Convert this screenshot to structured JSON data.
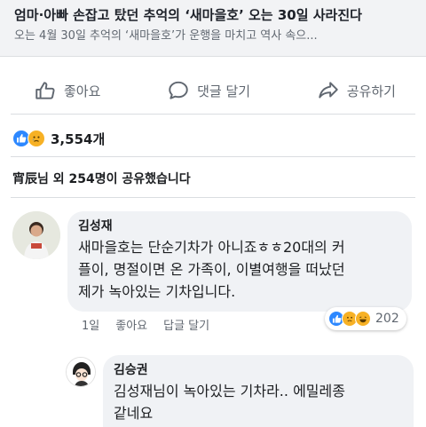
{
  "link": {
    "title": "엄마·아빠 손잡고 탔던 추억의 ‘새마을호’ 오는 30일 사라진다",
    "description": "오는 4월 30일 추억의 ‘새마을호’가 운행을 마치고 역사 속으..."
  },
  "actions": {
    "like": "좋아요",
    "comment": "댓글 달기",
    "share": "공유하기"
  },
  "reactions": {
    "count": "3,554개",
    "icons": [
      "like-icon",
      "sad-icon"
    ]
  },
  "shares": {
    "text": "宵辰님 외 254명이 공유했습니다"
  },
  "comments": [
    {
      "author": "김성재",
      "text": "새마을호는 단순기차가 아니죠ㅎㅎ20대의 커\n플이, 명절이면 온 가족이, 이별여행을 떠났던\n제가 녹아있는 기차입니다.",
      "time": "1일",
      "like_label": "좋아요",
      "reply_label": "답글 달기",
      "reaction_count": "202",
      "reaction_icons": [
        "like-icon",
        "sad-icon",
        "laugh-icon"
      ]
    },
    {
      "author": "김승권",
      "text": "김성재님이 녹아있는 기차라.. 에밀레종\n같네요"
    }
  ],
  "colors": {
    "like_blue": "#2d88ff",
    "emoji_yellow": "#f7b125",
    "bubble_gray": "#f0f2f5",
    "secondary_text": "#606770"
  }
}
